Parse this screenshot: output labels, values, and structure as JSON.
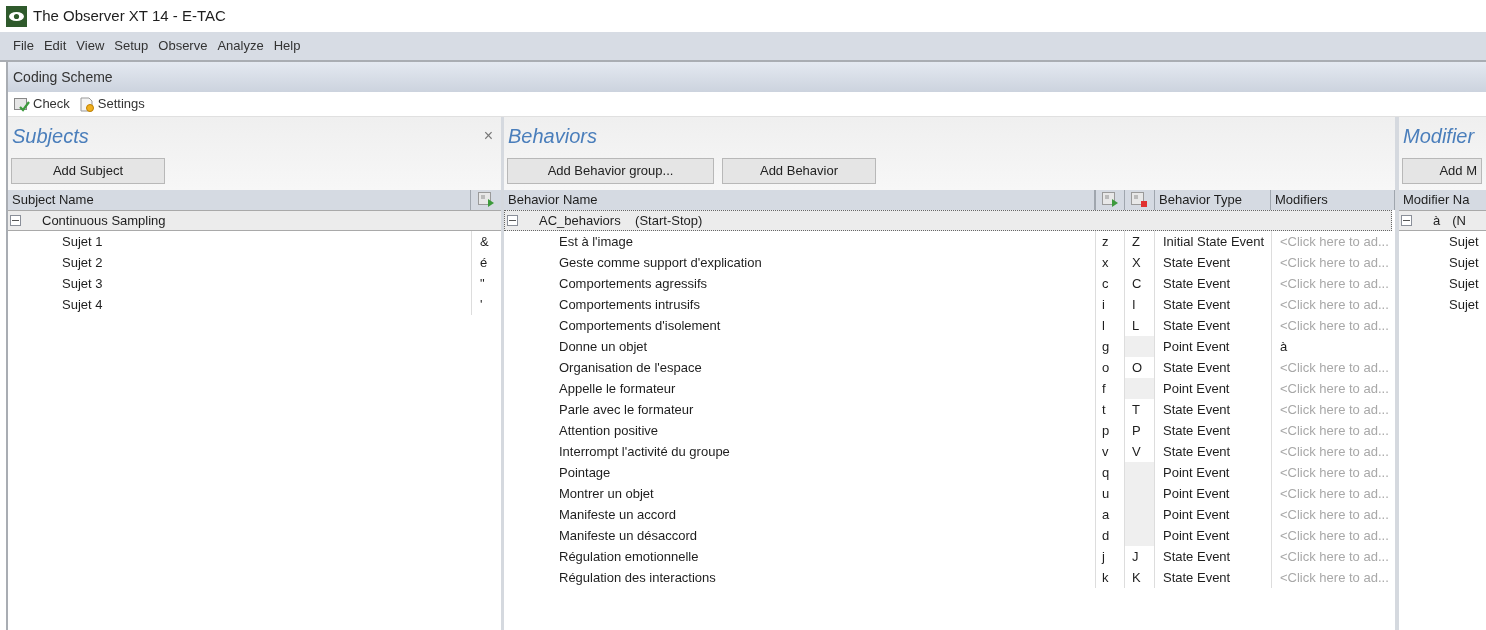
{
  "window": {
    "title": "The Observer XT 14 - E-TAC"
  },
  "menu": [
    "File",
    "Edit",
    "View",
    "Setup",
    "Observe",
    "Analyze",
    "Help"
  ],
  "section_title": "Coding Scheme",
  "toolbar": [
    {
      "kind": "check",
      "label": "Check"
    },
    {
      "kind": "settings",
      "label": "Settings"
    }
  ],
  "subjects": {
    "title": "Subjects",
    "close": "×",
    "add_button": "Add Subject",
    "columns": [
      "Subject Name"
    ],
    "group": {
      "name": "Continuous Sampling",
      "expanded": true
    },
    "rows": [
      {
        "name": "Sujet 1",
        "key": "&"
      },
      {
        "name": "Sujet 2",
        "key": "é"
      },
      {
        "name": "Sujet 3",
        "key": "\""
      },
      {
        "name": "Sujet 4",
        "key": "'"
      }
    ]
  },
  "behaviors": {
    "title": "Behaviors",
    "buttons": [
      "Add Behavior group...",
      "Add Behavior"
    ],
    "columns": [
      "Behavior Name",
      "Behavior Type",
      "Modifiers"
    ],
    "group": {
      "name": "AC_behaviors",
      "mode": "(Start-Stop)",
      "expanded": true
    },
    "rows": [
      {
        "name": "Est à l'image",
        "start_key": "z",
        "stop_key": "Z",
        "type": "Initial State Event",
        "modifiers": "<Click here to ad...",
        "modifiers_placeholder": true
      },
      {
        "name": "Geste comme support d'explication",
        "start_key": "x",
        "stop_key": "X",
        "type": "State Event",
        "modifiers": "<Click here to ad...",
        "modifiers_placeholder": true
      },
      {
        "name": "Comportements agressifs",
        "start_key": "c",
        "stop_key": "C",
        "type": "State Event",
        "modifiers": "<Click here to ad...",
        "modifiers_placeholder": true
      },
      {
        "name": "Comportements intrusifs",
        "start_key": "i",
        "stop_key": "I",
        "type": "State Event",
        "modifiers": "<Click here to ad...",
        "modifiers_placeholder": true
      },
      {
        "name": "Comportements d'isolement",
        "start_key": "l",
        "stop_key": "L",
        "type": "State Event",
        "modifiers": "<Click here to ad...",
        "modifiers_placeholder": true
      },
      {
        "name": "Donne un objet",
        "start_key": "g",
        "stop_disabled": true,
        "type": "Point Event",
        "modifiers": "à",
        "modifiers_placeholder": false
      },
      {
        "name": "Organisation de l'espace",
        "start_key": "o",
        "stop_key": "O",
        "type": "State Event",
        "modifiers": "<Click here to ad...",
        "modifiers_placeholder": true
      },
      {
        "name": "Appelle le formateur",
        "start_key": "f",
        "stop_disabled": true,
        "type": "Point Event",
        "modifiers": "<Click here to ad...",
        "modifiers_placeholder": true
      },
      {
        "name": "Parle avec le formateur",
        "start_key": "t",
        "stop_key": "T",
        "type": "State Event",
        "modifiers": "<Click here to ad...",
        "modifiers_placeholder": true
      },
      {
        "name": "Attention positive",
        "start_key": "p",
        "stop_key": "P",
        "type": "State Event",
        "modifiers": "<Click here to ad...",
        "modifiers_placeholder": true
      },
      {
        "name": "Interrompt l'activité du groupe",
        "start_key": "v",
        "stop_key": "V",
        "type": "State Event",
        "modifiers": "<Click here to ad...",
        "modifiers_placeholder": true
      },
      {
        "name": "Pointage",
        "start_key": "q",
        "stop_disabled": true,
        "type": "Point Event",
        "modifiers": "<Click here to ad...",
        "modifiers_placeholder": true
      },
      {
        "name": "Montrer un objet",
        "start_key": "u",
        "stop_disabled": true,
        "type": "Point Event",
        "modifiers": "<Click here to ad...",
        "modifiers_placeholder": true
      },
      {
        "name": "Manifeste un accord",
        "start_key": "a",
        "stop_disabled": true,
        "type": "Point Event",
        "modifiers": "<Click here to ad...",
        "modifiers_placeholder": true
      },
      {
        "name": "Manifeste un désaccord",
        "start_key": "d",
        "stop_disabled": true,
        "type": "Point Event",
        "modifiers": "<Click here to ad...",
        "modifiers_placeholder": true
      },
      {
        "name": "Régulation emotionnelle",
        "start_key": "j",
        "stop_key": "J",
        "type": "State Event",
        "modifiers": "<Click here to ad...",
        "modifiers_placeholder": true
      },
      {
        "name": "Régulation des interactions",
        "start_key": "k",
        "stop_key": "K",
        "type": "State Event",
        "modifiers": "<Click here to ad...",
        "modifiers_placeholder": true
      }
    ]
  },
  "modifiers": {
    "title": "Modifier",
    "add_button": "Add M",
    "columns": [
      "Modifier Na"
    ],
    "group": {
      "key": "à",
      "name": "(N",
      "expanded": true
    },
    "rows": [
      "Sujet",
      "Sujet",
      "Sujet",
      "Sujet"
    ]
  }
}
